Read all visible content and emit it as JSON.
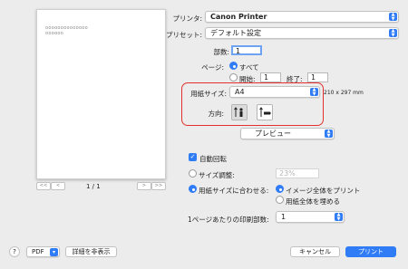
{
  "preview": {
    "text_line1": "oooooooooooooo",
    "text_line2": "oooooo",
    "page_indicator": "1 / 1",
    "first_label": "<<",
    "prev_label": "<",
    "next_label": ">",
    "last_label": ">>"
  },
  "printer": {
    "label": "プリンタ:",
    "value": "Canon Printer"
  },
  "presets": {
    "label": "プリセット:",
    "value": "デフォルト設定"
  },
  "copies": {
    "label": "部数:",
    "value": "1"
  },
  "pages": {
    "label": "ページ:",
    "all_label": "すべて",
    "from_label": "開始:",
    "from_value": "1",
    "to_label": "終了:",
    "to_value": "1",
    "selected": "all"
  },
  "paper_size": {
    "label": "用紙サイズ:",
    "value": "A4",
    "dimensions": "210 x 297 mm"
  },
  "orientation": {
    "label": "方向:",
    "selected": "portrait"
  },
  "section_popup": {
    "value": "プレビュー"
  },
  "auto_rotate": {
    "label": "自動回転",
    "checked": true
  },
  "scale": {
    "label": "サイズ調整:",
    "value": "23%"
  },
  "scale_to_fit": {
    "label": "用紙サイズに合わせる:",
    "option1": "イメージ全体をプリント",
    "option2": "用紙全体を埋める"
  },
  "pages_per_sheet": {
    "label": "1ページあたりの印刷部数:",
    "value": "1"
  },
  "footer": {
    "help": "?",
    "pdf": "PDF",
    "hide_details": "詳細を非表示",
    "cancel": "キャンセル",
    "print": "プリント"
  },
  "colors": {
    "accent": "#2f7cf6",
    "highlight": "#e2312d"
  }
}
